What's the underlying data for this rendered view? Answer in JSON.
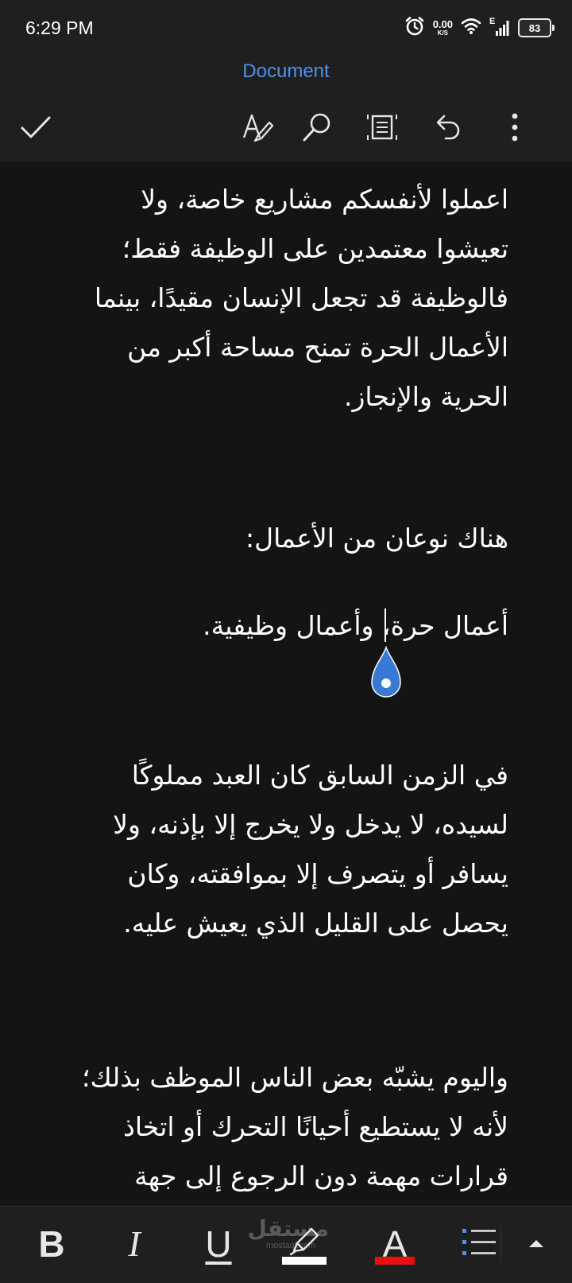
{
  "status_bar": {
    "time": "6:29 PM",
    "net_speed_value": "0.00",
    "net_speed_unit": "K/S",
    "signal_label": "E",
    "battery": "83"
  },
  "header": {
    "title": "Document"
  },
  "toolbar": {
    "icons": [
      "check-icon",
      "text-style-pen-icon",
      "search-icon",
      "view-mode-icon",
      "undo-icon",
      "more-vertical-icon"
    ]
  },
  "document": {
    "paragraphs": [
      "اعملوا لأنفسكم مشاريع خاصة، ولا تعيشوا معتمدين على الوظيفة فقط؛ فالوظيفة قد تجعل الإنسان مقيدًا، بينما الأعمال الحرة تمنح مساحة أكبر من الحرية والإنجاز.",
      "هناك نوعان من الأعمال:",
      "أعمال حرة، وأعمال وظيفية.",
      "في الزمن السابق كان العبد مملوكًا لسيده، لا يدخل ولا يخرج إلا بإذنه، ولا يسافر أو يتصرف إلا بموافقته، وكان يحصل على القليل الذي يعيش عليه.",
      "واليوم يشبّه بعض الناس الموظف بذلك؛ لأنه لا يستطيع أحيانًا التحرك أو اتخاذ قرارات مهمة دون الرجوع إلى جهة"
    ]
  },
  "format_bar": {
    "bold": "B",
    "italic": "I",
    "underline": "U",
    "font_color": "A",
    "highlight_color": "#ffffff",
    "font_color_value": "#e81010"
  },
  "watermark": {
    "arabic": "مستقل",
    "latin": "mostaql.com"
  },
  "colors": {
    "accent": "#4f90e8",
    "background": "#141414",
    "bar": "#1f1f1f"
  }
}
